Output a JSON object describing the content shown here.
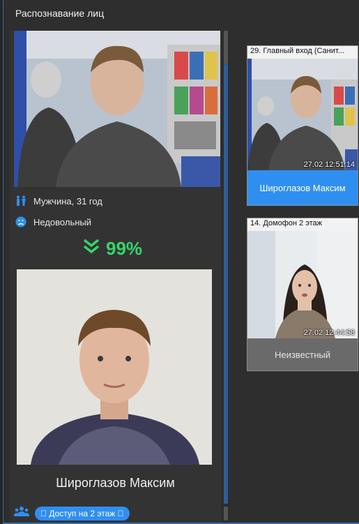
{
  "window": {
    "title": "Распознавание лиц"
  },
  "current": {
    "gender_age": "Мужчина, 31 год",
    "emotion": "Недовольный",
    "match_percent": "99%",
    "name": "Широглазов Максим",
    "access_label": " Доступ на 2 этаж "
  },
  "events": [
    {
      "camera": "29. Главный вход (Санит...",
      "timestamp": "27.02 12:51:14",
      "name": "Широглазов Максим",
      "status": "known"
    },
    {
      "camera": "14. Домофон 2 этаж",
      "timestamp": "27.02 12:44:58",
      "name": "Неизвестный",
      "status": "unknown"
    }
  ],
  "colors": {
    "accent": "#2f8ff0",
    "match": "#37d46b",
    "background": "#2e2e2e"
  },
  "icons": {
    "gender": "people-gender-icon",
    "emotion": "unhappy-face-icon",
    "match": "double-chevron-down-icon",
    "group": "group-users-icon"
  }
}
